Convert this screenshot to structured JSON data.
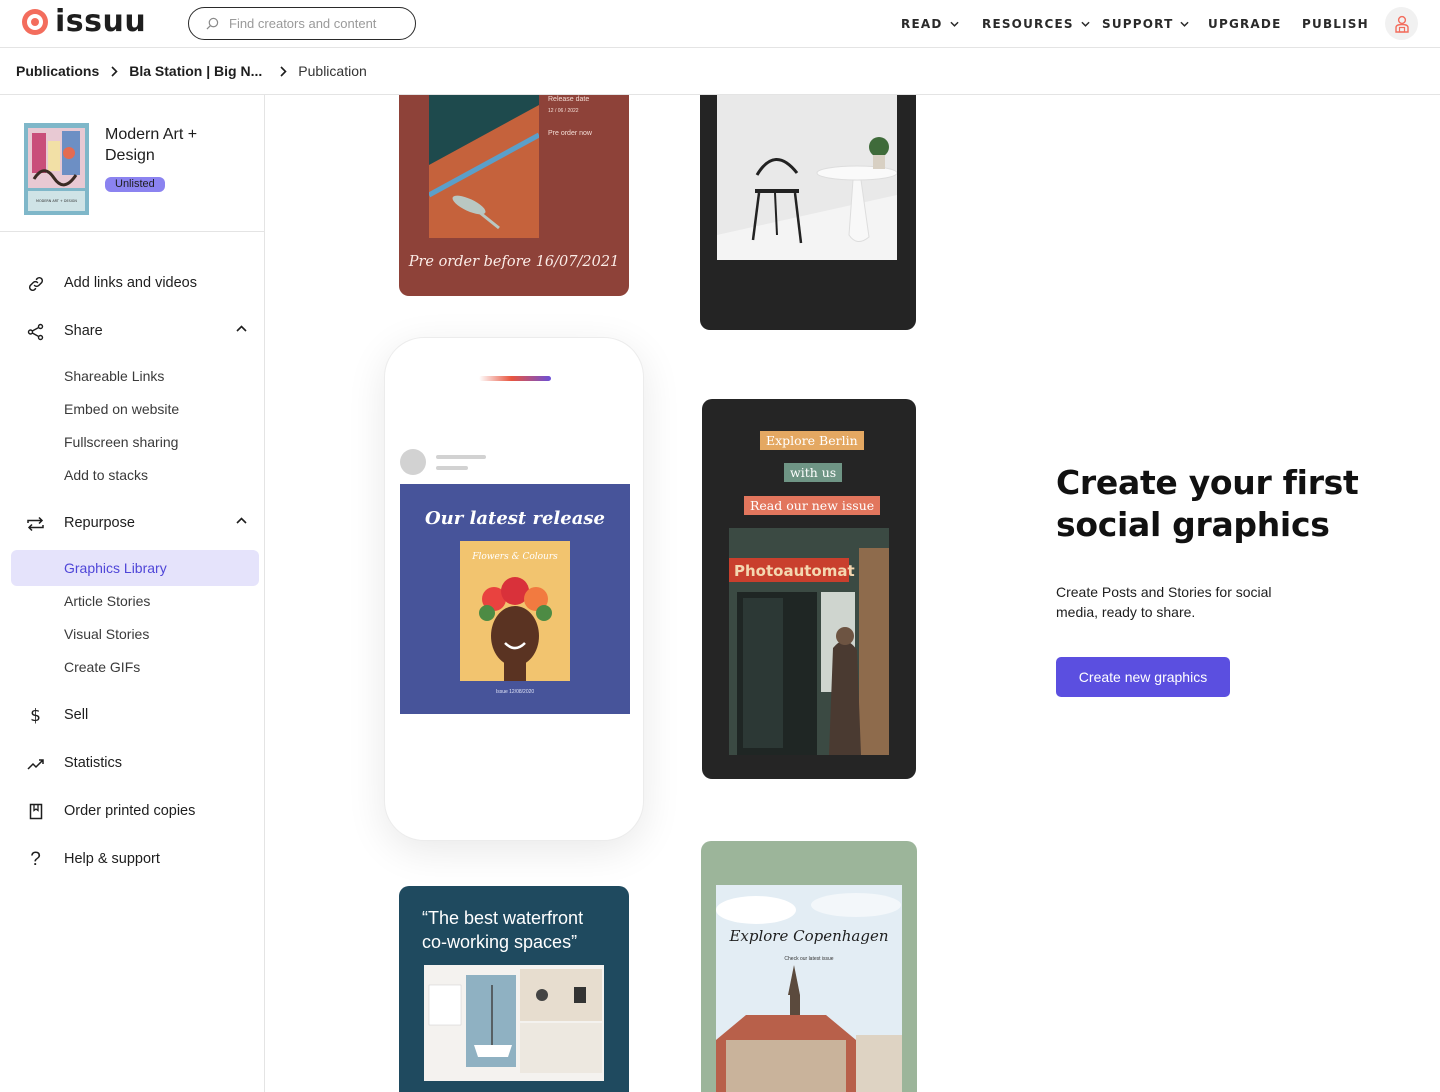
{
  "header": {
    "logo_text": "issuu",
    "search_placeholder": "Find creators and content",
    "nav": [
      "READ",
      "RESOURCES",
      "SUPPORT",
      "UPGRADE",
      "PUBLISH"
    ]
  },
  "breadcrumb": {
    "items": [
      "Publications",
      "Bla Station | Big N...",
      "Publication"
    ]
  },
  "publication": {
    "title": "Modern Art + Design",
    "status": "Unlisted",
    "cover_text": "MODERN ART + DESIGN"
  },
  "sidebar": {
    "add_links": "Add links and videos",
    "share": "Share",
    "share_items": [
      "Shareable Links",
      "Embed on website",
      "Fullscreen sharing",
      "Add to stacks"
    ],
    "repurpose": "Repurpose",
    "repurpose_items": [
      "Graphics Library",
      "Article Stories",
      "Visual Stories",
      "Create GIFs"
    ],
    "sell": "Sell",
    "statistics": "Statistics",
    "order": "Order printed copies",
    "help": "Help & support"
  },
  "graphics": {
    "card1_release": "Release date",
    "card1_date": "12 / 06 / 2022",
    "card1_preorder": "Pre order now",
    "card1_footer": "Pre order before 16/07/2021",
    "card3_title": "Our latest release",
    "card3_cover_text": "Flowers & Colours",
    "card3_issue": "Issue 12/08/2020",
    "card4_line1": "Explore Berlin",
    "card4_line2": "with us",
    "card4_line3": "Read our new issue",
    "card4_sign": "Photoautomat",
    "card5_quote": "“The best waterfront co-working spaces”",
    "card6_title": "Explore Copenhagen",
    "card6_sub": "Check our latest issue"
  },
  "hero": {
    "heading": "Create your first social graphics",
    "description": "Create Posts  and Stories for social media, ready to share.",
    "button": "Create new graphics"
  },
  "colors": {
    "accent": "#5b4fe0",
    "active_bg": "#e5e3fb",
    "badge": "#8b83f0",
    "logo": "#f36d5d"
  },
  "icons": [
    "search-icon",
    "chevron-down-icon",
    "user-icon",
    "chevron-right-icon",
    "link-icon",
    "share-icon",
    "chevron-up-icon",
    "repurpose-icon",
    "dollar-icon",
    "trend-icon",
    "book-icon",
    "question-icon"
  ]
}
